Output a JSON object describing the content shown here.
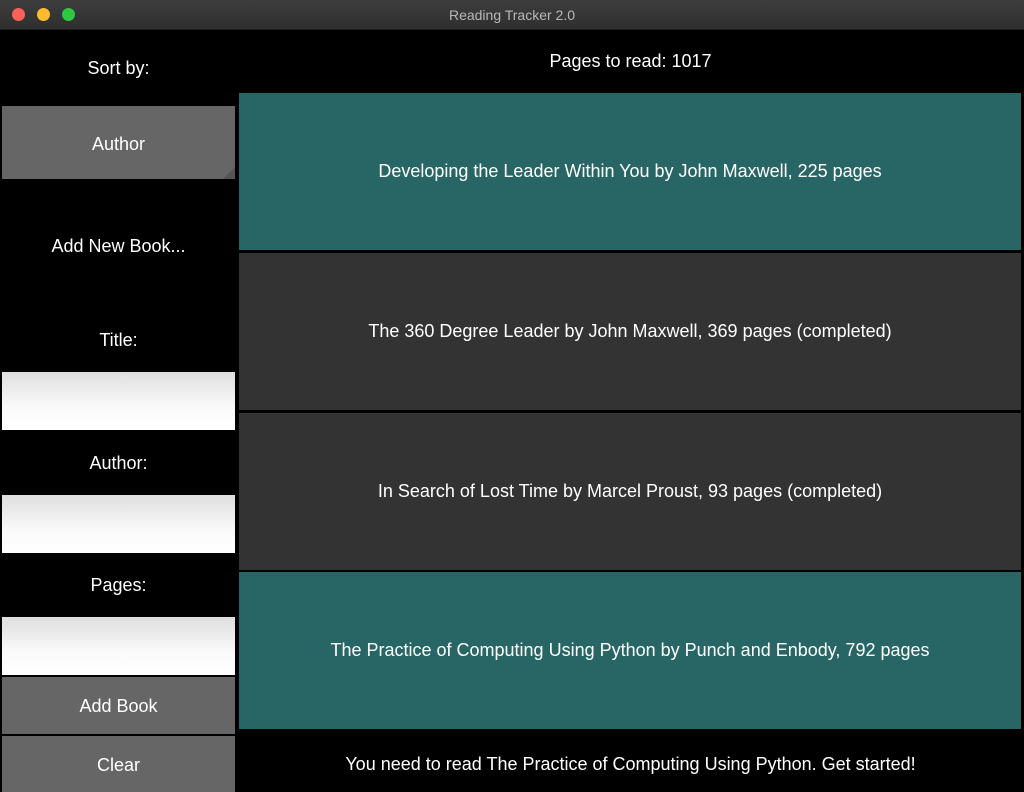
{
  "window": {
    "title": "Reading Tracker 2.0"
  },
  "sidebar": {
    "sort_label": "Sort by:",
    "sort_value": "Author",
    "add_heading": "Add New Book...",
    "title_label": "Title:",
    "title_value": "",
    "author_label": "Author:",
    "author_value": "",
    "pages_label": "Pages:",
    "pages_value": "",
    "add_button": "Add Book",
    "clear_button": "Clear"
  },
  "main": {
    "pages_to_read": "Pages to read: 1017",
    "books": [
      {
        "text": "Developing the Leader Within You by John Maxwell, 225 pages",
        "completed": false
      },
      {
        "text": "The 360 Degree Leader by John Maxwell, 369 pages (completed)",
        "completed": true
      },
      {
        "text": "In Search of Lost Time by Marcel Proust, 93 pages (completed)",
        "completed": true
      },
      {
        "text": "The Practice of Computing Using Python by Punch and Enbody, 792 pages",
        "completed": false
      }
    ],
    "status": "You need to read The Practice of Computing Using Python. Get started!"
  },
  "colors": {
    "pending_book": "#286565",
    "completed_book": "#333333",
    "button": "#666666",
    "background": "#000000"
  }
}
